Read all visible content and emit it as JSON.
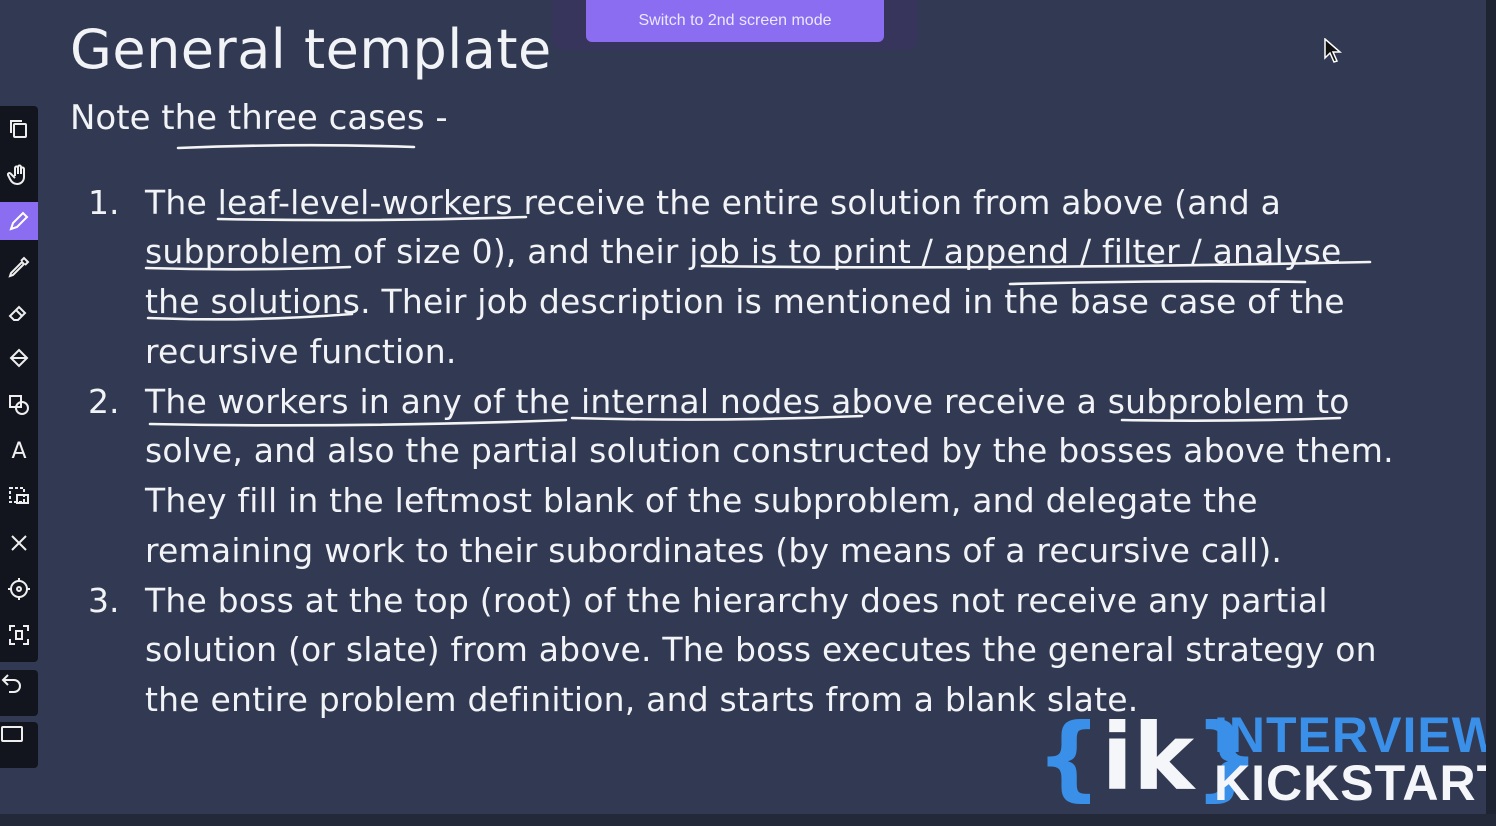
{
  "slide": {
    "title": "General template",
    "subtitle": "Note the three cases -",
    "items": [
      {
        "number": "1.",
        "lines": [
          "The leaf-level-workers receive the entire solution from above (and a",
          "subproblem of size 0), and their job is to print / append / filter / analyse",
          "the solutions. Their job description is mentioned in the base case of the",
          "recursive function."
        ]
      },
      {
        "number": "2.",
        "lines": [
          "The workers in any of the internal nodes above receive a subproblem to",
          "solve, and also the partial solution constructed by the bosses above them.",
          "They fill in the leftmost blank of the subproblem, and delegate the",
          "remaining work to their subordinates (by means of a recursive call)."
        ]
      },
      {
        "number": "3.",
        "lines": [
          "The boss at the top (root) of the hierarchy does not receive any partial",
          "solution (or slate) from above. The boss executes the general strategy on",
          "the entire problem definition, and starts from a blank slate."
        ]
      }
    ]
  },
  "overlay": {
    "switch_button_label": "Switch to 2nd screen mode"
  },
  "toolbar": {
    "tools": [
      {
        "icon": "copy-page-icon"
      },
      {
        "icon": "hand-icon"
      },
      {
        "icon": "pen-icon",
        "active": true
      },
      {
        "icon": "marker-icon"
      },
      {
        "icon": "eraser-icon"
      },
      {
        "icon": "fill-icon"
      },
      {
        "icon": "shapes-icon"
      },
      {
        "icon": "text-icon",
        "label": "A"
      },
      {
        "icon": "select-icon"
      },
      {
        "icon": "close-icon"
      },
      {
        "icon": "laser-pointer-icon"
      },
      {
        "icon": "capture-icon"
      },
      {
        "icon": "undo-icon"
      },
      {
        "icon": "screen-icon"
      }
    ]
  },
  "logo": {
    "mark_open": "{",
    "mark_text": "ik",
    "mark_close": "}",
    "line1": "INTERVIEW",
    "line2": "KICKSTART"
  },
  "colors": {
    "background": "#313a52",
    "text": "#f2f3f6",
    "accent": "#8a6df0",
    "logo_blue": "#3a8fe8"
  }
}
